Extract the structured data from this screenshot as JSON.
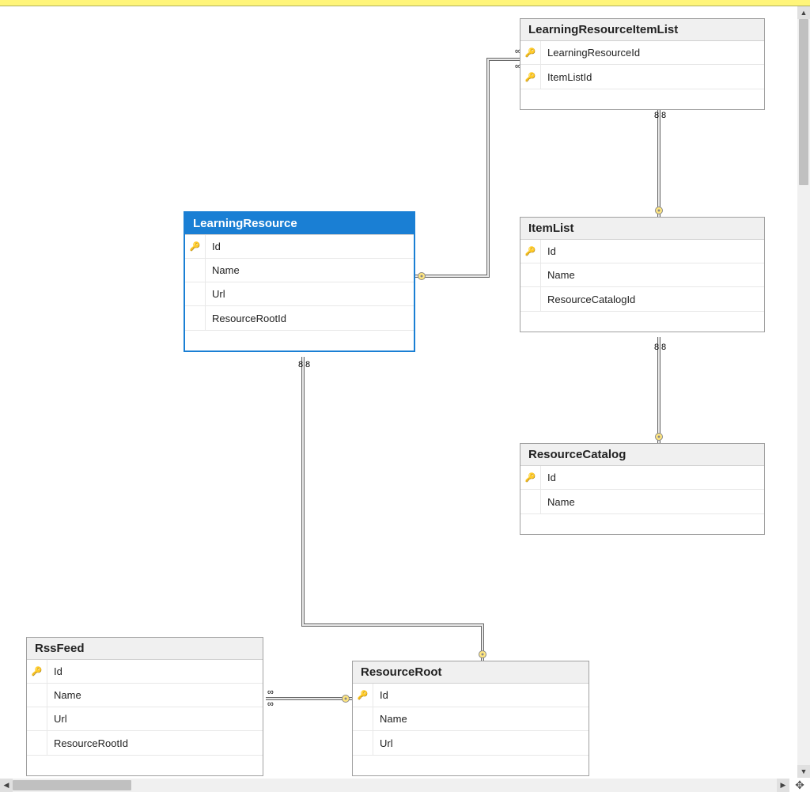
{
  "entities": {
    "learningResourceItemList": {
      "title": "LearningResourceItemList",
      "columns": [
        {
          "key": true,
          "name": "LearningResourceId"
        },
        {
          "key": true,
          "name": "ItemListId"
        }
      ]
    },
    "learningResource": {
      "title": "LearningResource",
      "selected": true,
      "columns": [
        {
          "key": true,
          "name": "Id"
        },
        {
          "key": false,
          "name": "Name"
        },
        {
          "key": false,
          "name": "Url"
        },
        {
          "key": false,
          "name": "ResourceRootId"
        }
      ]
    },
    "itemList": {
      "title": "ItemList",
      "columns": [
        {
          "key": true,
          "name": "Id"
        },
        {
          "key": false,
          "name": "Name"
        },
        {
          "key": false,
          "name": "ResourceCatalogId"
        }
      ]
    },
    "resourceCatalog": {
      "title": "ResourceCatalog",
      "columns": [
        {
          "key": true,
          "name": "Id"
        },
        {
          "key": false,
          "name": "Name"
        }
      ]
    },
    "rssFeed": {
      "title": "RssFeed",
      "columns": [
        {
          "key": true,
          "name": "Id"
        },
        {
          "key": false,
          "name": "Name"
        },
        {
          "key": false,
          "name": "Url"
        },
        {
          "key": false,
          "name": "ResourceRootId"
        }
      ]
    },
    "resourceRoot": {
      "title": "ResourceRoot",
      "columns": [
        {
          "key": true,
          "name": "Id"
        },
        {
          "key": false,
          "name": "Name"
        },
        {
          "key": false,
          "name": "Url"
        }
      ]
    }
  },
  "relationships": [
    {
      "from": "LearningResource",
      "to": "LearningResourceItemList",
      "type": "one-to-many"
    },
    {
      "from": "ItemList",
      "to": "LearningResourceItemList",
      "type": "one-to-many"
    },
    {
      "from": "ResourceCatalog",
      "to": "ItemList",
      "type": "one-to-many"
    },
    {
      "from": "ResourceRoot",
      "to": "LearningResource",
      "type": "one-to-many"
    },
    {
      "from": "ResourceRoot",
      "to": "RssFeed",
      "type": "one-to-many"
    }
  ]
}
